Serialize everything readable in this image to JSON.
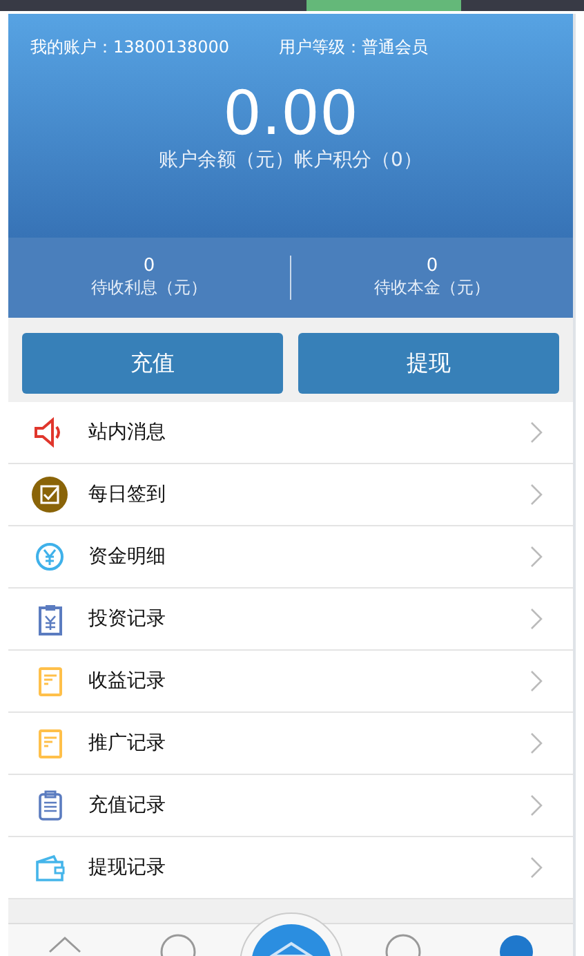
{
  "account": {
    "label": "我的账户：",
    "value": "13800138000"
  },
  "level": {
    "label": "用户等级：",
    "value": "普通会员"
  },
  "balance": {
    "amount": "0.00",
    "caption": "账户余额（元）帐户积分（0）"
  },
  "stats": [
    {
      "value": "0",
      "label": "待收利息（元）"
    },
    {
      "value": "0",
      "label": "待收本金（元）"
    }
  ],
  "buttons": [
    "充值",
    "提现"
  ],
  "menu": [
    {
      "kind": "speaker",
      "label": "站内消息"
    },
    {
      "kind": "checkin",
      "label": "每日签到"
    },
    {
      "kind": "yen",
      "label": "资金明细"
    },
    {
      "kind": "yenclip",
      "label": "投资记录"
    },
    {
      "kind": "doc",
      "label": "收益记录"
    },
    {
      "kind": "doc",
      "label": "推广记录"
    },
    {
      "kind": "clip",
      "label": "充值记录"
    },
    {
      "kind": "wallet",
      "label": "提现记录"
    }
  ]
}
